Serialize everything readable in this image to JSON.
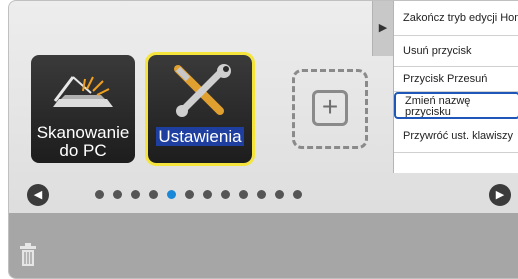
{
  "tiles": [
    {
      "label_line1": "Skanowanie",
      "label_line2": "do PC",
      "icon": "scanner-icon"
    },
    {
      "label": "Ustawienia",
      "icon": "wrench-screwdriver-icon"
    }
  ],
  "add_tile": {
    "icon": "plus-icon",
    "symbol": "+"
  },
  "menu": {
    "handle_icon": "expand-arrow-icon",
    "handle_symbol": "▶",
    "items": [
      {
        "label": "Zakończ tryb edycji Home"
      },
      {
        "label": "Usuń przycisk"
      },
      {
        "label": "Przycisk Przesuń"
      },
      {
        "label": "Zmień nazwę przycisku"
      },
      {
        "label": "Przywróć ust. klawiszy"
      }
    ]
  },
  "pagination": {
    "prev_symbol": "◀",
    "next_symbol": "▶",
    "page_count": 12,
    "active_page": 5
  },
  "colors": {
    "selection_outline": "#f5e43c",
    "active_dot": "#1a88d8",
    "menu_selected_border": "#1e57b8",
    "label_highlight": "#1f3fa0"
  },
  "bottom_bar": {
    "trash_icon": "trash-icon"
  }
}
